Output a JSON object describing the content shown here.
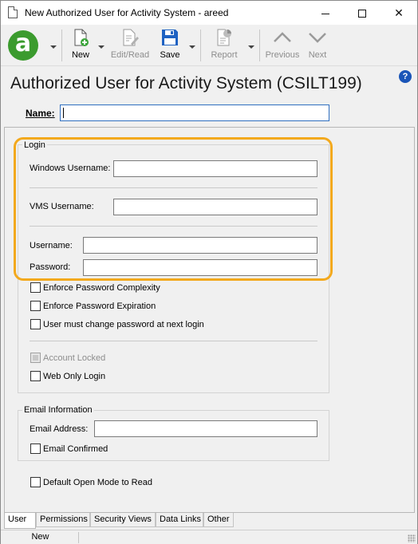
{
  "window": {
    "title": "New Authorized User for Activity System  - areed"
  },
  "toolbar": {
    "app_logo_letter": "a",
    "new_label": "New",
    "edit_read_label": "Edit/Read",
    "save_label": "Save",
    "report_label": "Report",
    "previous_label": "Previous",
    "next_label": "Next"
  },
  "page": {
    "title": "Authorized User for Activity System (CSILT199)",
    "help_glyph": "?"
  },
  "name_field": {
    "label": "Name:",
    "value": ""
  },
  "login": {
    "legend": "Login",
    "windows_username_label": "Windows Username:",
    "windows_username_value": "",
    "vms_username_label": "VMS Username:",
    "vms_username_value": "",
    "username_label": "Username:",
    "username_value": "",
    "password_label": "Password:",
    "password_value": "",
    "checkboxes": {
      "enforce_complexity": "Enforce Password Complexity",
      "enforce_expiration": "Enforce Password Expiration",
      "must_change": "User must change password at next login",
      "account_locked": "Account Locked",
      "web_only": "Web Only Login"
    }
  },
  "email": {
    "legend": "Email Information",
    "address_label": "Email Address:",
    "address_value": "",
    "confirmed_label": "Email Confirmed"
  },
  "default_open_label": "Default Open Mode to Read",
  "tabs": [
    "User",
    "Permissions",
    "Security Views",
    "Data Links",
    "Other"
  ],
  "status": {
    "mode": "New"
  },
  "colors": {
    "highlight": "#f3a91d",
    "logo": "#3b9b2e",
    "save_icon": "#1e62c2",
    "help": "#1a55b8"
  }
}
